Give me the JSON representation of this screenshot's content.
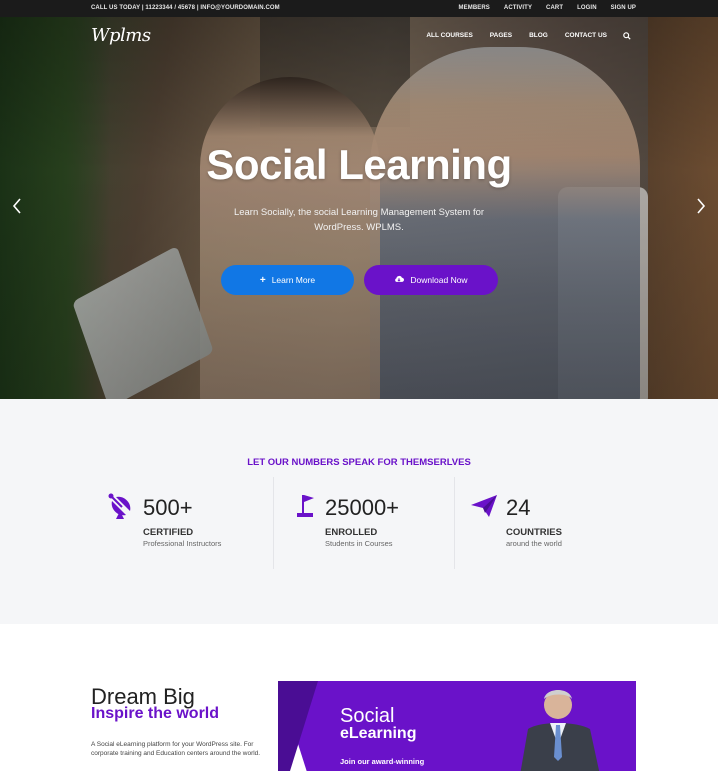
{
  "topbar": {
    "contact": "CALL US TODAY | 11223344 / 45678 | INFO@YOURDOMAIN.COM",
    "links": [
      "MEMBERS",
      "ACTIVITY",
      "CART",
      "LOGIN",
      "SIGN UP"
    ]
  },
  "header": {
    "logo": "Wplms",
    "menu": [
      "ALL COURSES",
      "PAGES",
      "BLOG",
      "CONTACT US"
    ],
    "search_icon": "search-icon"
  },
  "hero": {
    "title": "Social Learning",
    "subtitle": "Learn Socially, the social Learning Management System for WordPress. WPLMS.",
    "buttons": {
      "learn_more": "Learn More",
      "download_now": "Download Now"
    },
    "prev_icon": "chevron-left-icon",
    "next_icon": "chevron-right-icon"
  },
  "stats": {
    "heading": "LET OUR NUMBERS SPEAK FOR THEMSERLVES",
    "items": [
      {
        "icon": "satellite-dish-icon",
        "number": "500+",
        "label": "CERTIFIED",
        "sub": "Professional Instructors"
      },
      {
        "icon": "flag-icon",
        "number": "25000+",
        "label": "ENROLLED",
        "sub": "Students in Courses"
      },
      {
        "icon": "paper-plane-icon",
        "number": "24",
        "label": "COUNTRIES",
        "sub": "around the world"
      }
    ]
  },
  "dream": {
    "title": "Dream Big",
    "subtitle": "Inspire the world",
    "text": "A Social eLearning platform for your WordPress site. For corporate training and Education centers around the world."
  },
  "promo": {
    "title": "Social",
    "title2": "eLearning",
    "text": "Join our award-winning"
  },
  "colors": {
    "accent_purple": "#6a12c9",
    "accent_blue": "#1177e5",
    "topbar_bg": "#1b1b1b",
    "stats_bg": "#f5f6f8"
  }
}
